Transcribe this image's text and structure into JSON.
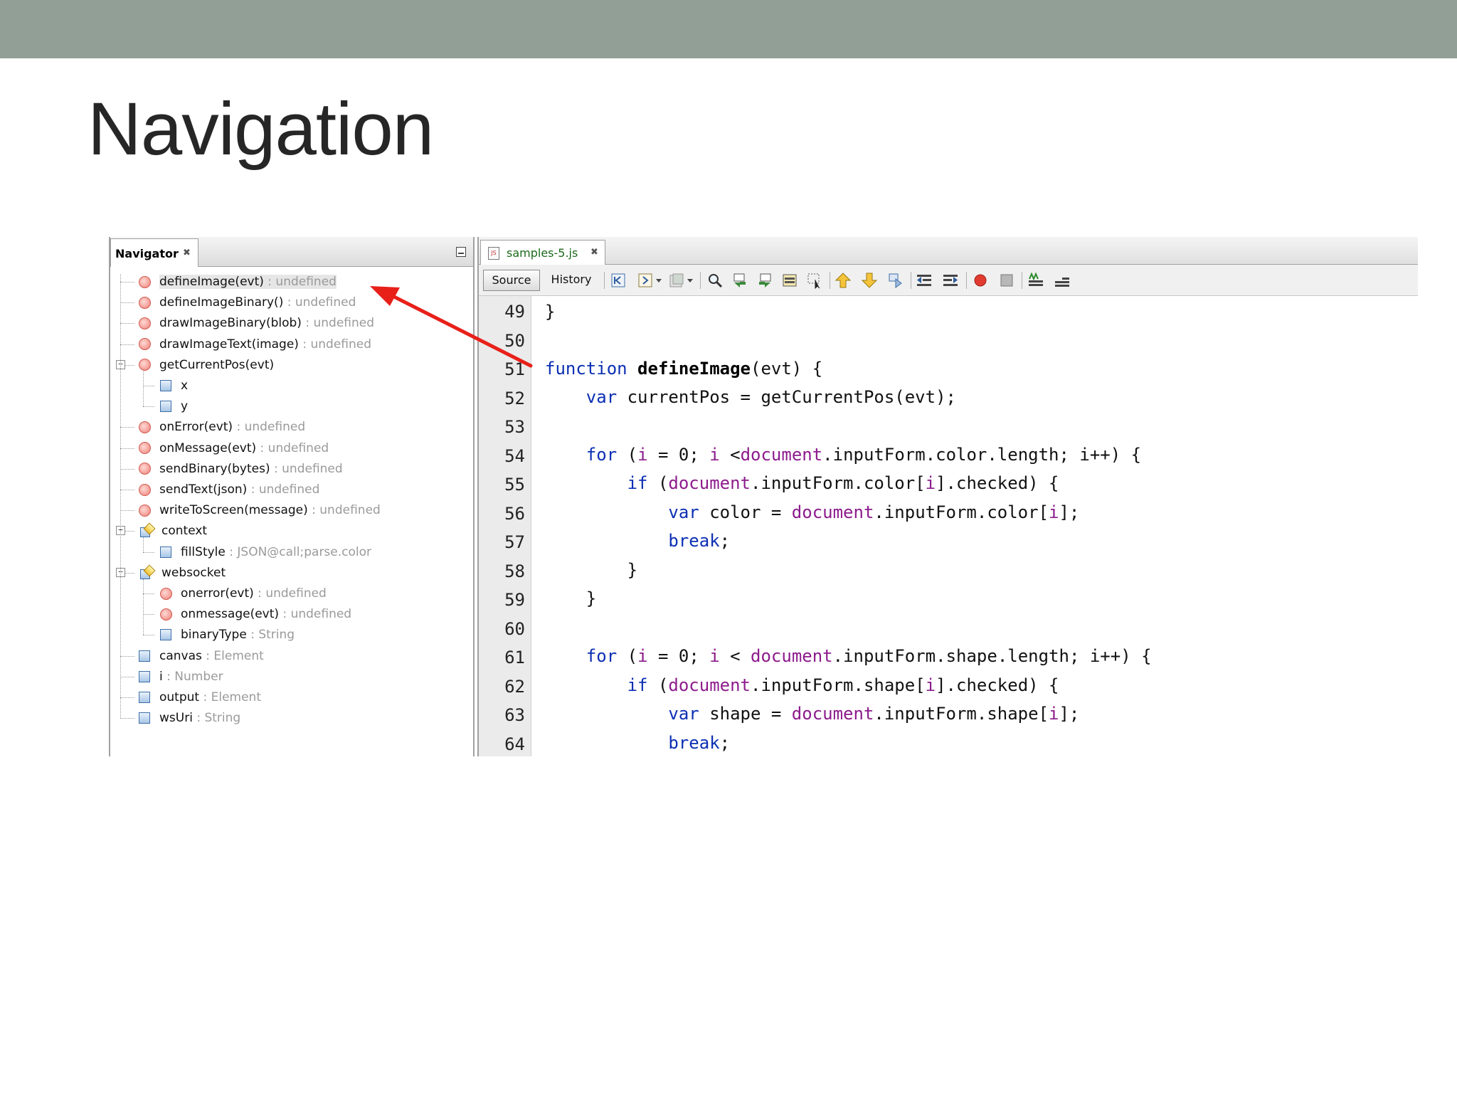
{
  "slide": {
    "title": "Navigation"
  },
  "navigator": {
    "tab_label": "Navigator",
    "close_glyph": "✖",
    "items": [
      {
        "name": "defineImage(evt)",
        "type": " : undefined",
        "icon": "method",
        "selected": true
      },
      {
        "name": "defineImageBinary()",
        "type": " : undefined",
        "icon": "method"
      },
      {
        "name": "drawImageBinary(blob)",
        "type": " : undefined",
        "icon": "method"
      },
      {
        "name": "drawImageText(image)",
        "type": " : undefined",
        "icon": "method"
      },
      {
        "name": "getCurrentPos(evt)",
        "type": "",
        "icon": "method",
        "expanded": true
      },
      {
        "name": "x",
        "type": "",
        "icon": "field"
      },
      {
        "name": "y",
        "type": "",
        "icon": "field"
      },
      {
        "name": "onError(evt)",
        "type": " : undefined",
        "icon": "method"
      },
      {
        "name": "onMessage(evt)",
        "type": " : undefined",
        "icon": "method"
      },
      {
        "name": "sendBinary(bytes)",
        "type": " : undefined",
        "icon": "method"
      },
      {
        "name": "sendText(json)",
        "type": " : undefined",
        "icon": "method"
      },
      {
        "name": "writeToScreen(message)",
        "type": " : undefined",
        "icon": "method"
      },
      {
        "name": "context",
        "type": "",
        "icon": "object",
        "expanded": true
      },
      {
        "name": "fillStyle",
        "type": " : JSON@call;parse.color",
        "icon": "field"
      },
      {
        "name": "websocket",
        "type": "",
        "icon": "object",
        "expanded": true
      },
      {
        "name": "onerror(evt)",
        "type": " : undefined",
        "icon": "method"
      },
      {
        "name": "onmessage(evt)",
        "type": " : undefined",
        "icon": "method"
      },
      {
        "name": "binaryType",
        "type": " : String",
        "icon": "field"
      },
      {
        "name": "canvas",
        "type": " : Element",
        "icon": "field"
      },
      {
        "name": "i",
        "type": " : Number",
        "icon": "field"
      },
      {
        "name": "output",
        "type": " : Element",
        "icon": "field"
      },
      {
        "name": "wsUri",
        "type": " : String",
        "icon": "field"
      }
    ]
  },
  "editor": {
    "file_tab": "samples-5.js",
    "close_glyph": "✖",
    "source_label": "Source",
    "history_label": "History",
    "line_numbers": [
      "49",
      "50",
      "51",
      "52",
      "53",
      "54",
      "55",
      "56",
      "57",
      "58",
      "59",
      "60",
      "61",
      "62",
      "63",
      "64"
    ],
    "code": {
      "l49": "}",
      "l51_kw": "function",
      "l51_fn": "defineImage",
      "l51_rest": "(evt) {",
      "l52_kw": "var",
      "l52_rest": " currentPos = getCurrentPos(evt);",
      "l54_kw": "for",
      "l54_a": " (",
      "l54_i1": "i",
      "l54_b": " = 0; ",
      "l54_i2": "i",
      "l54_c": " <",
      "l54_doc": "document",
      "l54_d": ".inputForm.color.length; i++) {",
      "l55_kw": "if",
      "l55_a": " (",
      "l55_doc": "document",
      "l55_b": ".inputForm.color[",
      "l55_i": "i",
      "l55_c": "].checked) {",
      "l56_kw": "var",
      "l56_a": " color = ",
      "l56_doc": "document",
      "l56_b": ".inputForm.color[",
      "l56_i": "i",
      "l56_c": "];",
      "l57_kw": "break",
      "l57_rest": ";",
      "l58": "}",
      "l59": "}",
      "l61_kw": "for",
      "l61_a": " (",
      "l61_i1": "i",
      "l61_b": " = 0; ",
      "l61_i2": "i",
      "l61_c": " < ",
      "l61_doc": "document",
      "l61_d": ".inputForm.shape.length; i++) {",
      "l62_kw": "if",
      "l62_a": " (",
      "l62_doc": "document",
      "l62_b": ".inputForm.shape[",
      "l62_i": "i",
      "l62_c": "].checked) {",
      "l63_kw": "var",
      "l63_a": " shape = ",
      "l63_doc": "document",
      "l63_b": ".inputForm.shape[",
      "l63_i": "i",
      "l63_c": "];",
      "l64_kw": "break",
      "l64_rest": ";"
    }
  },
  "toolbar_icons": [
    "back-icon",
    "forward-history-icon",
    "dropdown-icon",
    "last-edit-icon",
    "dropdown-icon",
    "find-icon",
    "find-previous-icon",
    "find-next-icon",
    "toggle-highlight-icon",
    "find-selection-icon",
    "previous-bookmark-icon",
    "next-bookmark-icon",
    "toggle-bookmark-icon",
    "shift-left-icon",
    "shift-right-icon",
    "start-macro-icon",
    "stop-macro-icon",
    "comment-icon",
    "uncomment-icon"
  ],
  "colors": {
    "top_bar": "#919f97",
    "arrow": "#e8201a",
    "keyword": "#0b2fb3",
    "global": "#8c1b8c"
  }
}
